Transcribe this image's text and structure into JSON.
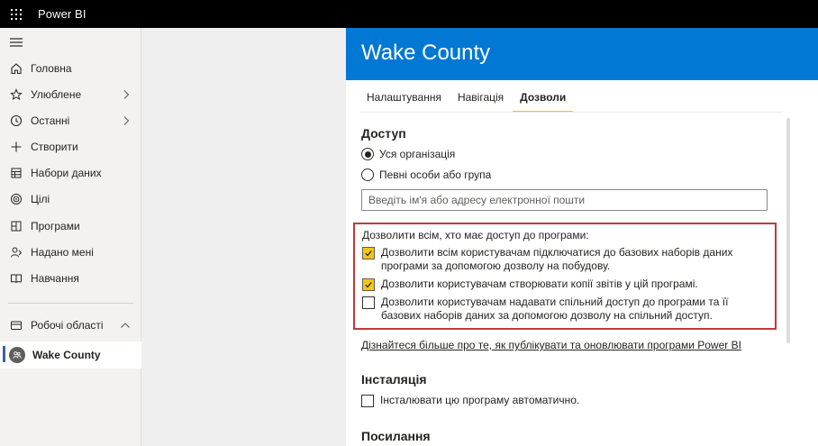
{
  "app": {
    "title": "Power BI"
  },
  "nav": {
    "items": [
      {
        "label": "Головна",
        "icon": "home-icon"
      },
      {
        "label": "Улюблене",
        "icon": "star-icon"
      },
      {
        "label": "Останні",
        "icon": "clock-icon"
      },
      {
        "label": "Створити",
        "icon": "plus-icon"
      },
      {
        "label": "Набори даних",
        "icon": "dataset-icon"
      },
      {
        "label": "Цілі",
        "icon": "goals-icon"
      },
      {
        "label": "Програми",
        "icon": "apps-icon"
      },
      {
        "label": "Надано мені",
        "icon": "shared-icon"
      },
      {
        "label": "Навчання",
        "icon": "learn-icon"
      }
    ],
    "workspaces_label": "Робочі області",
    "current_workspace": "Wake County"
  },
  "panel": {
    "title": "Wake County",
    "tabs": [
      {
        "label": "Налаштування",
        "active": false
      },
      {
        "label": "Навігація",
        "active": false
      },
      {
        "label": "Дозволи",
        "active": true
      }
    ],
    "access": {
      "title": "Доступ",
      "options": [
        {
          "label": "Уся організація",
          "selected": true
        },
        {
          "label": "Певні особи або група",
          "selected": false
        }
      ],
      "input_placeholder": "Введіть ім'я або адресу електронної пошти",
      "input_value": ""
    },
    "permissions": {
      "heading": "Дозволити всім, хто має доступ до програми:",
      "items": [
        {
          "label": "Дозволити всім користувачам підключатися до базових наборів даних програми за допомогою дозволу на побудову.",
          "checked": true
        },
        {
          "label": "Дозволити користувачам створювати копії звітів у цій програмі.",
          "checked": true
        },
        {
          "label": "Дозволити користувачам надавати спільний доступ до програми та її базових наборів даних за допомогою дозволу на спільний доступ.",
          "checked": false
        }
      ]
    },
    "learn_more": "Дізнайтеся більше про те, як публікувати та оновлювати програми Power BI",
    "install": {
      "title": "Інсталяція",
      "option_label": "Інсталювати цю програму автоматично.",
      "checked": false
    },
    "links_title": "Посилання"
  },
  "colors": {
    "header_blue": "#0078d4",
    "checkbox_yellow": "#f2c811",
    "highlight_red": "#c0393b",
    "topbar_black": "#000000"
  }
}
